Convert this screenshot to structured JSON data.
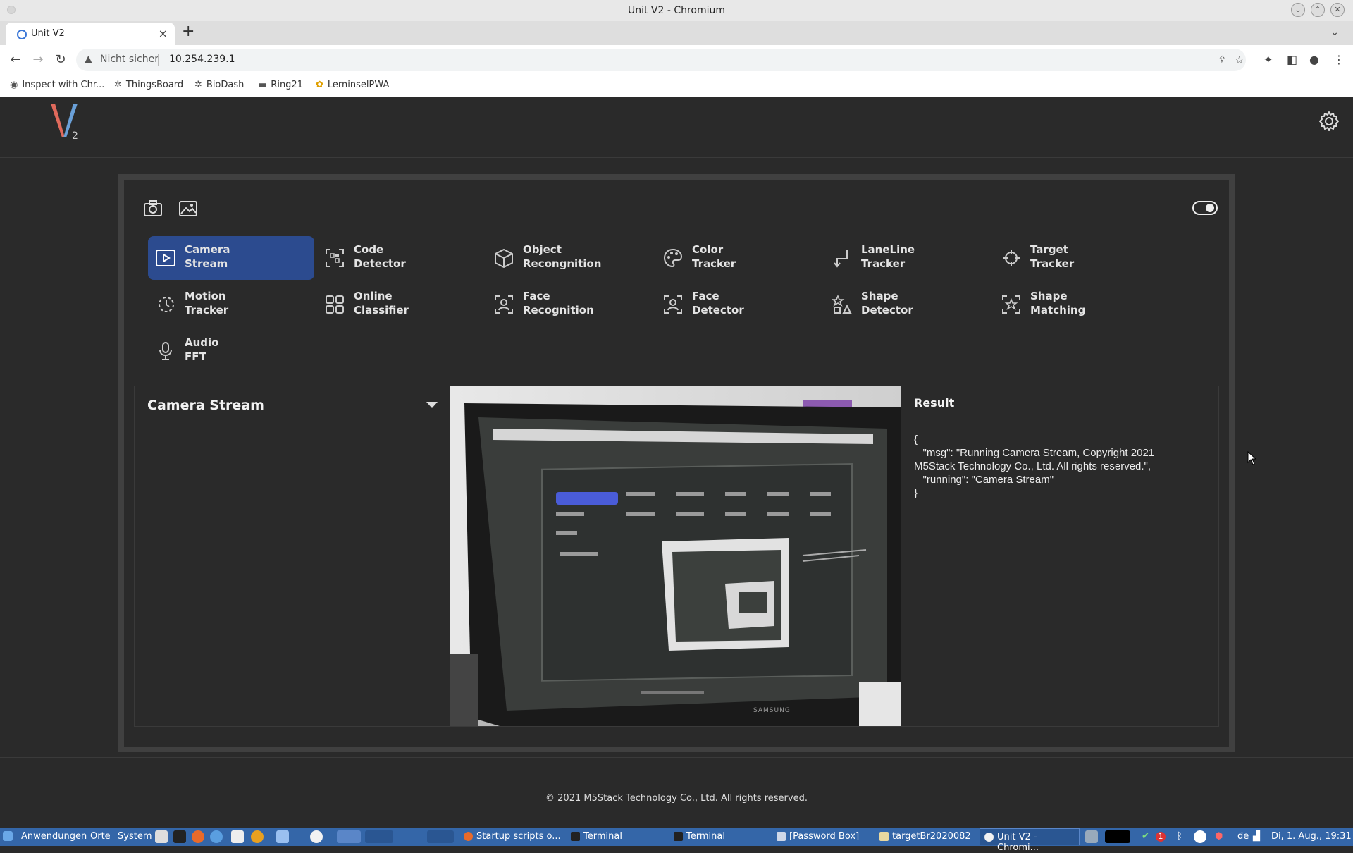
{
  "browser": {
    "window_title": "Unit V2 - Chromium",
    "tab_title": "Unit V2",
    "security_label": "Nicht sicher",
    "url": "10.254.239.1",
    "bookmarks": [
      {
        "label": "Inspect with Chr...",
        "icon": "globe-icon"
      },
      {
        "label": "ThingsBoard",
        "icon": "gear-icon"
      },
      {
        "label": "BioDash",
        "icon": "gear-icon"
      },
      {
        "label": "Ring21",
        "icon": "folder-icon"
      },
      {
        "label": "LerninselPWA",
        "icon": "app-icon"
      }
    ]
  },
  "app": {
    "logo_text": "V",
    "logo_sub": "2",
    "menu": [
      {
        "line1": "Camera",
        "line2": "Stream",
        "icon": "play-icon",
        "active": true
      },
      {
        "line1": "Code",
        "line2": "Detector",
        "icon": "qr-code-icon"
      },
      {
        "line1": "Object",
        "line2": "Recongnition",
        "icon": "cube-icon"
      },
      {
        "line1": "Color",
        "line2": "Tracker",
        "icon": "palette-icon"
      },
      {
        "line1": "LaneLine",
        "line2": "Tracker",
        "icon": "laneline-icon"
      },
      {
        "line1": "Target",
        "line2": "Tracker",
        "icon": "crosshair-icon"
      },
      {
        "line1": "Motion",
        "line2": "Tracker",
        "icon": "motion-icon"
      },
      {
        "line1": "Online",
        "line2": "Classifier",
        "icon": "grid-icon"
      },
      {
        "line1": "Face",
        "line2": "Recognition",
        "icon": "face-icon"
      },
      {
        "line1": "Face",
        "line2": "Detector",
        "icon": "face-icon"
      },
      {
        "line1": "Shape",
        "line2": "Detector",
        "icon": "shapes-icon"
      },
      {
        "line1": "Shape",
        "line2": "Matching",
        "icon": "star-match-icon"
      },
      {
        "line1": "Audio",
        "line2": "FFT",
        "icon": "microphone-icon"
      }
    ],
    "sidebar_title": "Camera Stream",
    "result_title": "Result",
    "result_json": "{\n   \"msg\": \"Running Camera Stream, Copyright 2021 M5Stack Technology Co., Ltd. All rights reserved.\",\n   \"running\": \"Camera Stream\"\n}",
    "footer": "© 2021 M5Stack Technology Co., Ltd. All rights reserved.",
    "accent_color": "#2c4b8f"
  },
  "taskbar": {
    "menus": [
      "Anwendungen",
      "Orte",
      "System"
    ],
    "tasks": [
      {
        "label": "Startup scripts o...",
        "icon": "firefox-icon"
      },
      {
        "label": "Terminal",
        "icon": "terminal-icon"
      },
      {
        "label": "Terminal",
        "icon": "terminal-icon"
      },
      {
        "label": "[Password Box]",
        "icon": "window-icon"
      },
      {
        "label": "targetBr2020082",
        "icon": "folder-icon"
      },
      {
        "label": "Unit V2 - Chromi...",
        "icon": "chromium-icon",
        "active": true
      }
    ],
    "lang": "de",
    "clock": "Di, 1. Aug., 19:31",
    "notification_count": "1"
  }
}
